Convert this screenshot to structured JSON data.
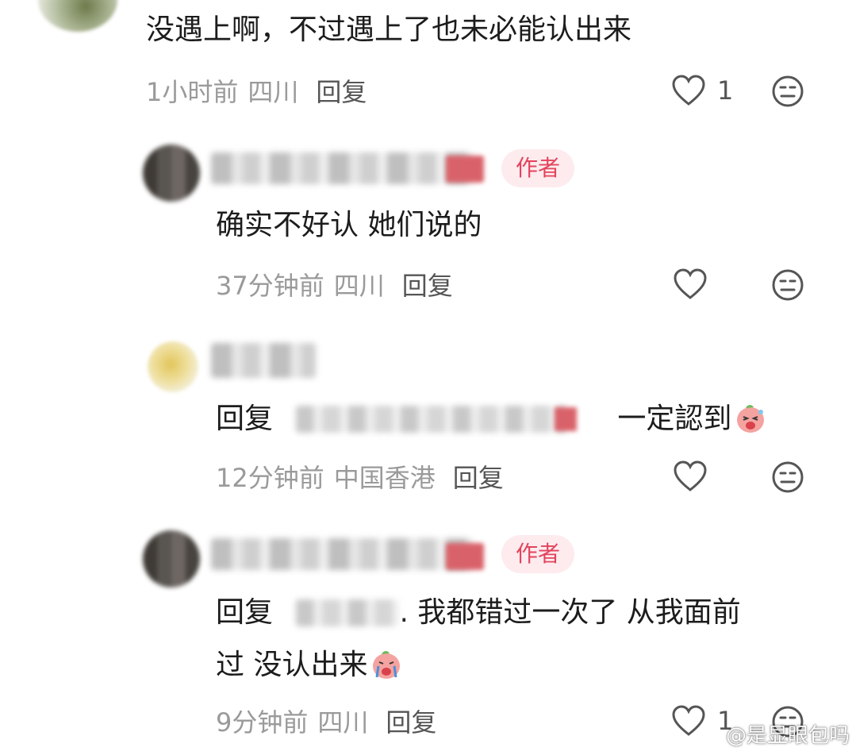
{
  "comments": [
    {
      "text": "没遇上啊，不过遇上了也未必能认出来",
      "time": "1小时前",
      "location": "四川",
      "reply_label": "回复",
      "likes": "1"
    },
    {
      "badge": "作者",
      "text": "确实不好认 她们说的",
      "time": "37分钟前",
      "location": "四川",
      "reply_label": "回复"
    },
    {
      "reply_prefix": "回复",
      "text": "一定認到",
      "emoji": "peach-laugh-emoji",
      "time": "12分钟前",
      "location": "中国香港",
      "reply_label": "回复"
    },
    {
      "badge": "作者",
      "reply_prefix": "回复",
      "text_line1": ". 我都错过一次了 从我面前",
      "text_line2": "过 没认出来",
      "emoji": "peach-cry-emoji",
      "time": "9分钟前",
      "location": "四川",
      "reply_label": "回复",
      "likes": "1"
    }
  ],
  "watermark": "@是显眼包吗",
  "icons": {
    "like": "heart-icon",
    "dislike": "neutral-face-icon"
  },
  "colors": {
    "badge_bg": "#fdebee",
    "badge_text": "#e2445c",
    "meta_text": "#9a9a9a"
  }
}
